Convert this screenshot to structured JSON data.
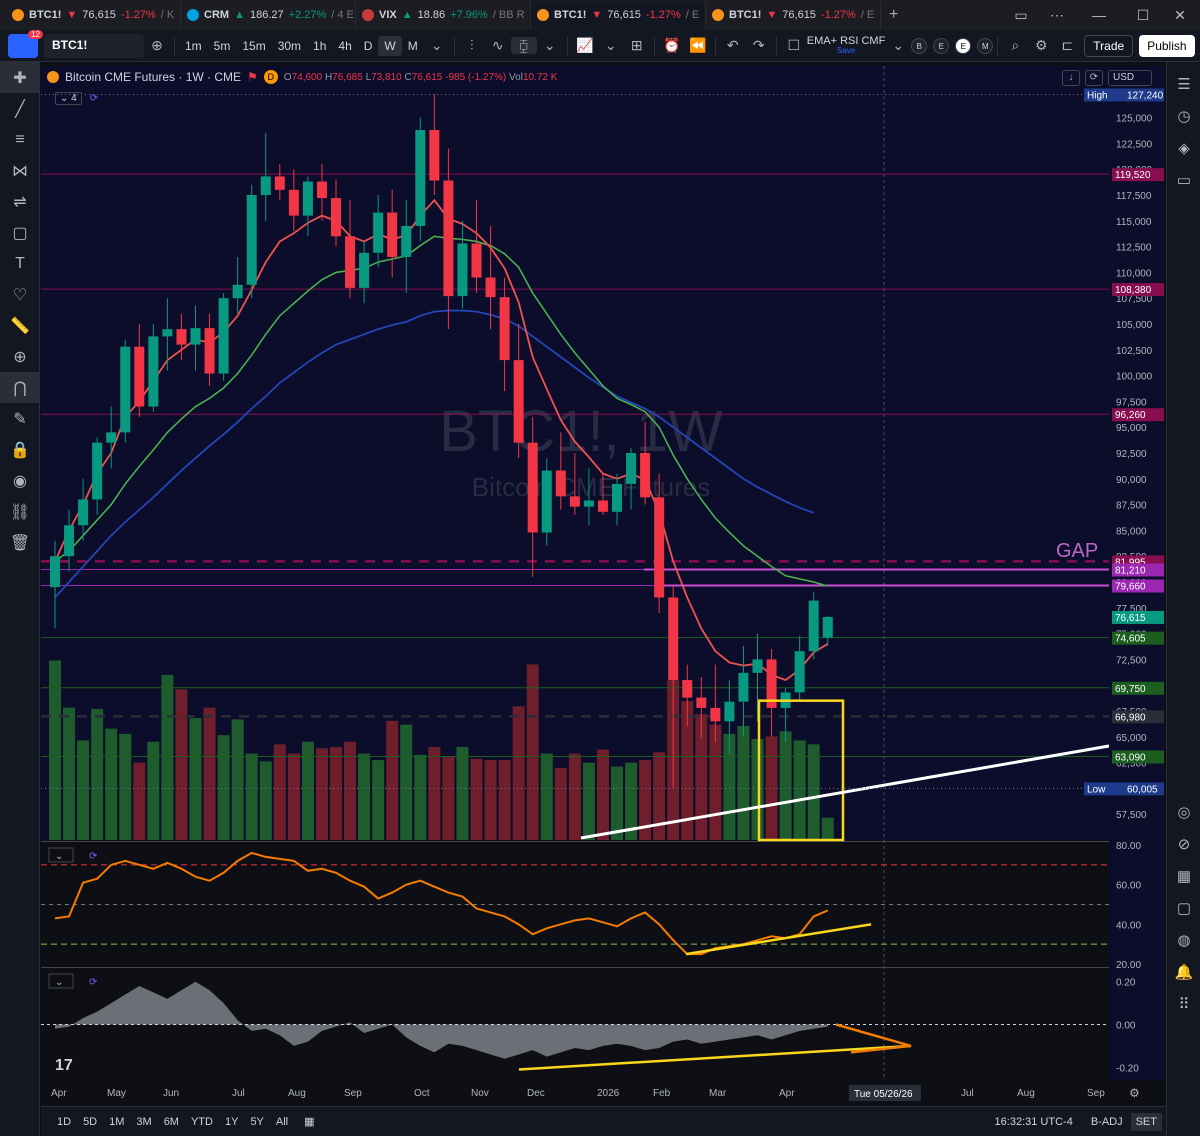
{
  "tabs": [
    {
      "symbol": "BTC1!",
      "arrow": "▼",
      "price": "76,615",
      "change": "-1.27%",
      "suffix": "/ K",
      "dir": "dn",
      "color": "#f7931a",
      "active": false
    },
    {
      "symbol": "CRM",
      "arrow": "▲",
      "price": "186.27",
      "change": "+2.27%",
      "suffix": "/ 4 E",
      "dir": "up",
      "color": "#00a1e0",
      "active": false
    },
    {
      "symbol": "VIX",
      "arrow": "▲",
      "price": "18.86",
      "change": "+7.96%",
      "suffix": "/ BB R",
      "dir": "up",
      "color": "#c83b3b",
      "active": false
    },
    {
      "symbol": "BTC1!",
      "arrow": "▼",
      "price": "76,615",
      "change": "-1.27%",
      "suffix": "/ E",
      "dir": "dn",
      "color": "#f7931a",
      "active": true
    },
    {
      "symbol": "BTC1!",
      "arrow": "▼",
      "price": "76,615",
      "change": "-1.27%",
      "suffix": "/ E",
      "dir": "dn",
      "color": "#f7931a",
      "active": false
    }
  ],
  "header": {
    "notif_count": "12",
    "symbol": "BTC1!",
    "intervals": [
      "1m",
      "5m",
      "15m",
      "30m",
      "1h",
      "4h",
      "D",
      "W",
      "M"
    ],
    "active_interval": "W",
    "template_name": "EMA+ RSI CMF",
    "template_sub": "Save",
    "indicator_letters": [
      "B",
      "E",
      "E",
      "M"
    ],
    "trade_label": "Trade",
    "publish_label": "Publish"
  },
  "legend": {
    "title": "Bitcoin CME Futures · 1W · CME",
    "flag": "D",
    "o": "74,600",
    "h": "76,685",
    "l": "73,810",
    "c": "76,615",
    "chg": "-985 (-1.27%)",
    "vol": "10.72 K",
    "o_label": "O",
    "h_label": "H",
    "l_label": "L",
    "c_label": "C",
    "vol_label": "Vol",
    "indicator_count": "4",
    "currency": "USD"
  },
  "watermark": {
    "symbol": "BTC1!, 1W",
    "name": "Bitcoin CME Futures"
  },
  "chart_data": {
    "type": "candlestick",
    "ylim": [
      55000,
      130000
    ],
    "y_ticks": [
      55000,
      57500,
      60000,
      62500,
      65000,
      67500,
      70000,
      72500,
      75000,
      77500,
      80000,
      82500,
      85000,
      87500,
      90000,
      92500,
      95000,
      97500,
      100000,
      102500,
      105000,
      107500,
      110000,
      112500,
      115000,
      117500,
      120000,
      122500,
      125000,
      127500,
      130000
    ],
    "x_labels": [
      "Apr",
      "May",
      "Jun",
      "Jul",
      "Aug",
      "Sep",
      "Oct",
      "Nov",
      "Dec",
      "2026",
      "Feb",
      "Mar",
      "Apr",
      "May",
      "Jun",
      "Jul",
      "Aug",
      "Sep"
    ],
    "crosshair_label": "Tue 05/26/26",
    "high_label": "High",
    "high_value": "127,240",
    "low_label": "Low",
    "low_value": "60,005",
    "price_lines": [
      {
        "value": 119520,
        "label": "119,520",
        "color": "#880e4f"
      },
      {
        "value": 108380,
        "label": "108,380",
        "color": "#880e4f"
      },
      {
        "value": 96260,
        "label": "96,260",
        "color": "#880e4f"
      },
      {
        "value": 81995,
        "label": "81,995",
        "color": "#880e4f",
        "dashed": true
      },
      {
        "value": 81210,
        "label": "81,210",
        "color": "#9c27b0"
      },
      {
        "value": 79660,
        "label": "79,660",
        "color": "#9c27b0"
      },
      {
        "value": 74605,
        "label": "74,605",
        "color": "#1b5e20"
      },
      {
        "value": 69750,
        "label": "69,750",
        "color": "#1b5e20"
      },
      {
        "value": 66980,
        "label": "66,980",
        "color": "#2a2e39",
        "dashed": true
      },
      {
        "value": 63090,
        "label": "63,090",
        "color": "#1b5e20"
      }
    ],
    "last_price": {
      "value": 76615,
      "label": "76,615"
    },
    "gap_label": "GAP",
    "candles": [
      [
        79500,
        84000,
        75500,
        82500
      ],
      [
        82500,
        87000,
        81000,
        85500
      ],
      [
        85500,
        90000,
        84000,
        88000
      ],
      [
        88000,
        94000,
        86500,
        93500
      ],
      [
        93500,
        97000,
        91000,
        94500
      ],
      [
        94500,
        103500,
        93500,
        102800
      ],
      [
        102800,
        105000,
        96000,
        97000
      ],
      [
        97000,
        105000,
        96500,
        103800
      ],
      [
        103800,
        107500,
        100500,
        104500
      ],
      [
        104500,
        106000,
        101500,
        103000
      ],
      [
        103000,
        106800,
        100500,
        104600
      ],
      [
        104600,
        106000,
        99000,
        100200
      ],
      [
        100200,
        108000,
        99500,
        107500
      ],
      [
        107500,
        111500,
        106000,
        108800
      ],
      [
        108800,
        118500,
        107500,
        117500
      ],
      [
        117500,
        123500,
        115000,
        119300
      ],
      [
        119300,
        120500,
        117000,
        118000
      ],
      [
        118000,
        120000,
        114000,
        115500
      ],
      [
        115500,
        119300,
        113500,
        118800
      ],
      [
        118800,
        120500,
        115000,
        117200
      ],
      [
        117200,
        119000,
        112500,
        113500
      ],
      [
        113500,
        117000,
        107500,
        108500
      ],
      [
        108500,
        113000,
        107000,
        111900
      ],
      [
        111900,
        117500,
        110500,
        115800
      ],
      [
        115800,
        118000,
        109500,
        111500
      ],
      [
        111500,
        117000,
        108000,
        114500
      ],
      [
        114500,
        125000,
        113000,
        123800
      ],
      [
        123800,
        127240,
        117500,
        118900
      ],
      [
        118900,
        122000,
        104500,
        107700
      ],
      [
        107700,
        115000,
        106500,
        112800
      ],
      [
        112800,
        117000,
        108000,
        109500
      ],
      [
        109500,
        114500,
        104500,
        107600
      ],
      [
        107600,
        109500,
        98500,
        101500
      ],
      [
        101500,
        105000,
        92000,
        93500
      ],
      [
        93500,
        96000,
        80500,
        84800
      ],
      [
        84800,
        92000,
        83500,
        90800
      ],
      [
        90800,
        94500,
        87000,
        88300
      ],
      [
        88300,
        92500,
        86500,
        87300
      ],
      [
        87300,
        91000,
        85500,
        87900
      ],
      [
        87900,
        90500,
        86500,
        86800
      ],
      [
        86800,
        90500,
        85500,
        89500
      ],
      [
        89500,
        93000,
        87000,
        92500
      ],
      [
        92500,
        95500,
        87500,
        88200
      ],
      [
        88200,
        90500,
        77000,
        78500
      ],
      [
        78500,
        79660,
        60005,
        70500
      ],
      [
        70500,
        72000,
        66000,
        68800
      ],
      [
        68800,
        70800,
        64800,
        67800
      ],
      [
        67800,
        72000,
        64500,
        66500
      ],
      [
        66500,
        70500,
        63300,
        68400
      ],
      [
        68400,
        73800,
        65000,
        71200
      ],
      [
        71200,
        75000,
        66500,
        72500
      ],
      [
        72500,
        73500,
        65000,
        67800
      ],
      [
        67800,
        69750,
        64500,
        69300
      ],
      [
        69300,
        74800,
        68500,
        73300
      ],
      [
        73300,
        79000,
        72500,
        78200
      ],
      [
        74600,
        76685,
        73810,
        76615
      ]
    ],
    "volumes": [
      13.7,
      10.1,
      7.6,
      10.0,
      8.5,
      8.1,
      5.9,
      7.5,
      12.6,
      11.5,
      9.3,
      10.1,
      8.0,
      9.2,
      6.6,
      6.0,
      7.3,
      6.6,
      7.5,
      7.0,
      7.1,
      7.5,
      6.6,
      6.1,
      9.1,
      8.8,
      6.5,
      7.1,
      6.4,
      7.1,
      6.2,
      6.1,
      6.1,
      10.2,
      13.4,
      6.6,
      5.5,
      6.6,
      5.9,
      6.9,
      5.6,
      5.9,
      6.1,
      6.7,
      12.2,
      10.6,
      9.6,
      8.8,
      8.1,
      8.7,
      7.7,
      7.9,
      8.3,
      7.6,
      7.3,
      1.7
    ],
    "ema_fast": [
      82000,
      85000,
      87500,
      90500,
      92500,
      96000,
      97500,
      99500,
      101500,
      102500,
      103500,
      103200,
      104200,
      105800,
      108300,
      111000,
      113000,
      113800,
      114800,
      115500,
      115000,
      113500,
      113000,
      113700,
      113200,
      113600,
      115500,
      117000,
      115200,
      114700,
      113800,
      112400,
      110400,
      107100,
      101800,
      98700,
      95700,
      93600,
      92100,
      90500,
      90000,
      90500,
      89900,
      86800,
      82000,
      78500,
      75500,
      73300,
      72200,
      71900,
      72100,
      71000,
      70500,
      71500,
      73200,
      74000
    ],
    "ema_slow": [
      82000,
      83000,
      84500,
      86000,
      87500,
      89500,
      91200,
      92800,
      94500,
      95800,
      97000,
      97800,
      98800,
      100200,
      102000,
      104000,
      105800,
      107000,
      108200,
      109300,
      110000,
      110200,
      110400,
      111000,
      111300,
      111600,
      112600,
      113500,
      113300,
      113200,
      113000,
      112600,
      111800,
      110500,
      108000,
      106000,
      104000,
      102200,
      100600,
      99000,
      97800,
      97200,
      96500,
      95000,
      92300,
      90000,
      88000,
      86200,
      84800,
      83500,
      82500,
      81500,
      80600,
      80300,
      80000,
      79600
    ],
    "sma_long": [
      78500,
      80000,
      81500,
      83000,
      84500,
      85800,
      87000,
      88200,
      89500,
      90800,
      92000,
      93200,
      94300,
      95500,
      96800,
      98000,
      99300,
      100300,
      101300,
      102200,
      103000,
      103500,
      104000,
      104500,
      104900,
      105200,
      105800,
      106200,
      106300,
      106300,
      106200,
      105900,
      105500,
      104800,
      103800,
      102800,
      101800,
      100800,
      99800,
      98900,
      98000,
      97400,
      96800,
      96000,
      95000,
      94000,
      93000,
      92000,
      91000,
      90000,
      89200,
      88500,
      87800,
      87200,
      86700
    ],
    "rsi": {
      "ylim": [
        20,
        80
      ],
      "ticks": [
        20,
        40,
        60,
        80
      ],
      "values": [
        43,
        44,
        61,
        63,
        70,
        72,
        70,
        68,
        71,
        68,
        64,
        62,
        66,
        72,
        76,
        74,
        73,
        72,
        67,
        68,
        66,
        62,
        59,
        53,
        56,
        60,
        62,
        59,
        56,
        54,
        48,
        46,
        44,
        40,
        35,
        38,
        40,
        42,
        43,
        41,
        39,
        43,
        46,
        40,
        32,
        25,
        25,
        28,
        29,
        30,
        32,
        34,
        33,
        35,
        44,
        47
      ]
    },
    "cmf": {
      "ylim": [
        -0.25,
        0.25
      ],
      "ticks": [
        -0.2,
        0,
        0.2
      ],
      "values": [
        -0.02,
        -0.01,
        0.03,
        0.06,
        0.1,
        0.14,
        0.18,
        0.15,
        0.12,
        0.16,
        0.2,
        0.16,
        0.1,
        0.02,
        -0.03,
        -0.02,
        -0.05,
        -0.1,
        -0.08,
        -0.03,
        -0.01,
        0.01,
        -0.04,
        -0.02,
        0.0,
        -0.06,
        -0.1,
        -0.13,
        -0.09,
        -0.1,
        -0.12,
        -0.14,
        -0.16,
        -0.14,
        -0.12,
        -0.15,
        -0.13,
        -0.11,
        -0.12,
        -0.1,
        -0.09,
        -0.1,
        -0.12,
        -0.11,
        -0.08,
        -0.07,
        -0.09,
        -0.08,
        -0.07,
        -0.06,
        -0.05,
        -0.07,
        -0.05,
        -0.03,
        -0.02,
        -0.01
      ]
    }
  },
  "bottom": {
    "ranges": [
      "1D",
      "5D",
      "1M",
      "3M",
      "6M",
      "YTD",
      "1Y",
      "5Y",
      "All"
    ],
    "time": "16:32:31 UTC-4",
    "adj": "B-ADJ",
    "set": "SET"
  },
  "colors": {
    "up": "#089981",
    "down": "#f23645",
    "ema_fast": "#ef5350",
    "ema_slow": "#4caf50",
    "sma": "#2545b8",
    "rsi": "#f57c00",
    "cmf": "#9598a1",
    "box": "#f9d71c",
    "trend": "#ffffff"
  }
}
